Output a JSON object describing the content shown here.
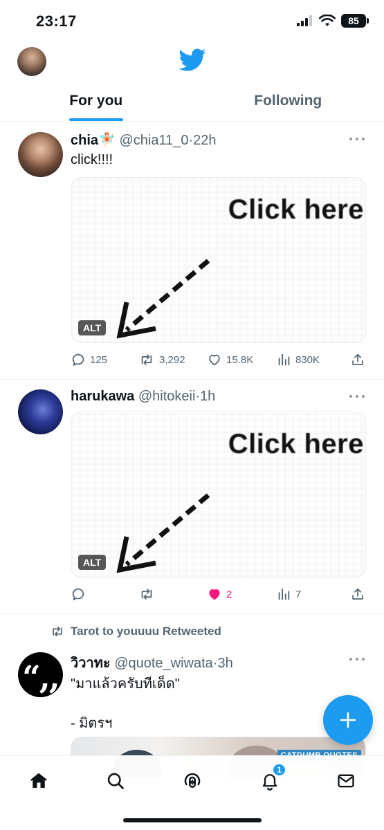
{
  "status_bar": {
    "time": "23:17",
    "battery": "85"
  },
  "header": {
    "logo_icon": "twitter-bird-icon",
    "avatar_icon": "avatar"
  },
  "tabs": [
    {
      "label": "For you",
      "active": true
    },
    {
      "label": "Following",
      "active": false
    }
  ],
  "tweets": [
    {
      "name": "chia🧚🏻",
      "handle": "@chia11_0",
      "time": "22h",
      "text": "click!!!!",
      "media_caption": "Click here",
      "alt_label": "ALT",
      "replies": "125",
      "retweets": "3,292",
      "likes": "15.8K",
      "views": "830K",
      "liked": false
    },
    {
      "name": "harukawa",
      "handle": "@hitokeii",
      "time": "1h",
      "text": "",
      "media_caption": "Click here",
      "alt_label": "ALT",
      "replies": "",
      "retweets": "",
      "likes": "2",
      "views": "7",
      "liked": true
    },
    {
      "retweeted_by": "Tarot to youuuu Retweeted",
      "name": "วิวาทะ",
      "handle": "@quote_wiwata",
      "time": "3h",
      "text_line1": "\"มาแล้วครับทีเด็ด\"",
      "text_line2": "- มิตรฯ",
      "avatar_text": "“,,",
      "preview_tag": "CATDUMB QUOTES"
    }
  ],
  "bottom_nav": {
    "items": [
      "home-icon",
      "search-icon",
      "spaces-icon",
      "notifications-icon",
      "messages-icon"
    ],
    "notification_count": "1"
  },
  "colors": {
    "accent": "#1d9bf0",
    "like": "#f91880",
    "secondary_text": "#536471"
  }
}
